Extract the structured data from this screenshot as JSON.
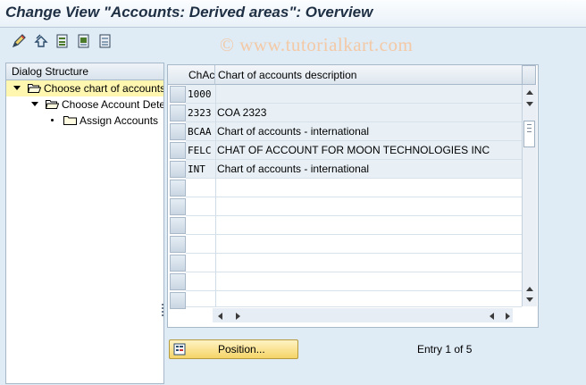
{
  "window": {
    "title": "Change View \"Accounts: Derived areas\": Overview"
  },
  "toolbar": {
    "buttons": [
      {
        "name": "display-change-icon"
      },
      {
        "name": "undo-icon"
      },
      {
        "name": "select-all-icon"
      },
      {
        "name": "select-block-icon"
      },
      {
        "name": "deselect-all-icon"
      }
    ]
  },
  "watermark": "© www.tutorialkart.com",
  "tree": {
    "header": "Dialog Structure",
    "items": [
      {
        "label": "Choose chart of accounts",
        "level": 1,
        "expanded": true,
        "selected": true
      },
      {
        "label": "Choose Account Determination",
        "level": 2,
        "expanded": true,
        "selected": false
      },
      {
        "label": "Assign Accounts",
        "level": 3,
        "expanded": false,
        "selected": false
      }
    ]
  },
  "table": {
    "columns": [
      "ChAc",
      "Chart of accounts description"
    ],
    "rows": [
      {
        "code": "1000",
        "description": ""
      },
      {
        "code": "2323",
        "description": "COA 2323"
      },
      {
        "code": "BCAA",
        "description": "Chart of accounts - international"
      },
      {
        "code": "FELC",
        "description": "CHAT OF ACCOUNT FOR MOON TECHNOLOGIES INC"
      },
      {
        "code": "INT",
        "description": "Chart of accounts - international"
      }
    ],
    "empty_rows": 7
  },
  "footer": {
    "position_button": "Position...",
    "entry_info": "Entry 1 of 5"
  },
  "colors": {
    "background": "#dfebf5",
    "selected_tree": "#fff7b0",
    "button_yellow": "#f5d467",
    "title_text": "#1e2f44",
    "watermark": "#f3c9a6"
  }
}
